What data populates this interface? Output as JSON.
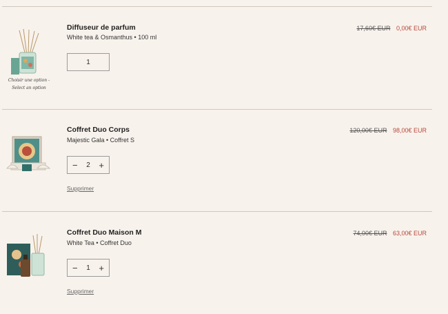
{
  "items": [
    {
      "title": "Diffuseur de parfum",
      "subtitle": "White tea & Osmanthus • 100 ml",
      "old_price": "17,60€ EUR",
      "new_price": "0,00€ EUR",
      "quantity": "1",
      "option_caption": "Choisir une option - Select an option",
      "image_icon": "reed-diffuser-icon"
    },
    {
      "title": "Coffret Duo Corps",
      "subtitle": "Majestic Gala • Coffret S",
      "old_price": "120,00€ EUR",
      "new_price": "98,00€ EUR",
      "quantity": "2",
      "remove_label": "Supprimer",
      "image_icon": "gift-box-icon"
    },
    {
      "title": "Coffret Duo Maison M",
      "subtitle": "White Tea • Coffret Duo",
      "old_price": "74,00€ EUR",
      "new_price": "63,00€ EUR",
      "quantity": "1",
      "remove_label": "Supprimer",
      "image_icon": "home-gift-set-icon"
    }
  ],
  "controls": {
    "minus": "−",
    "plus": "+"
  },
  "colors": {
    "background": "#f8f2ec",
    "sale_price": "#b5483c",
    "divider": "#cfc7bf"
  }
}
